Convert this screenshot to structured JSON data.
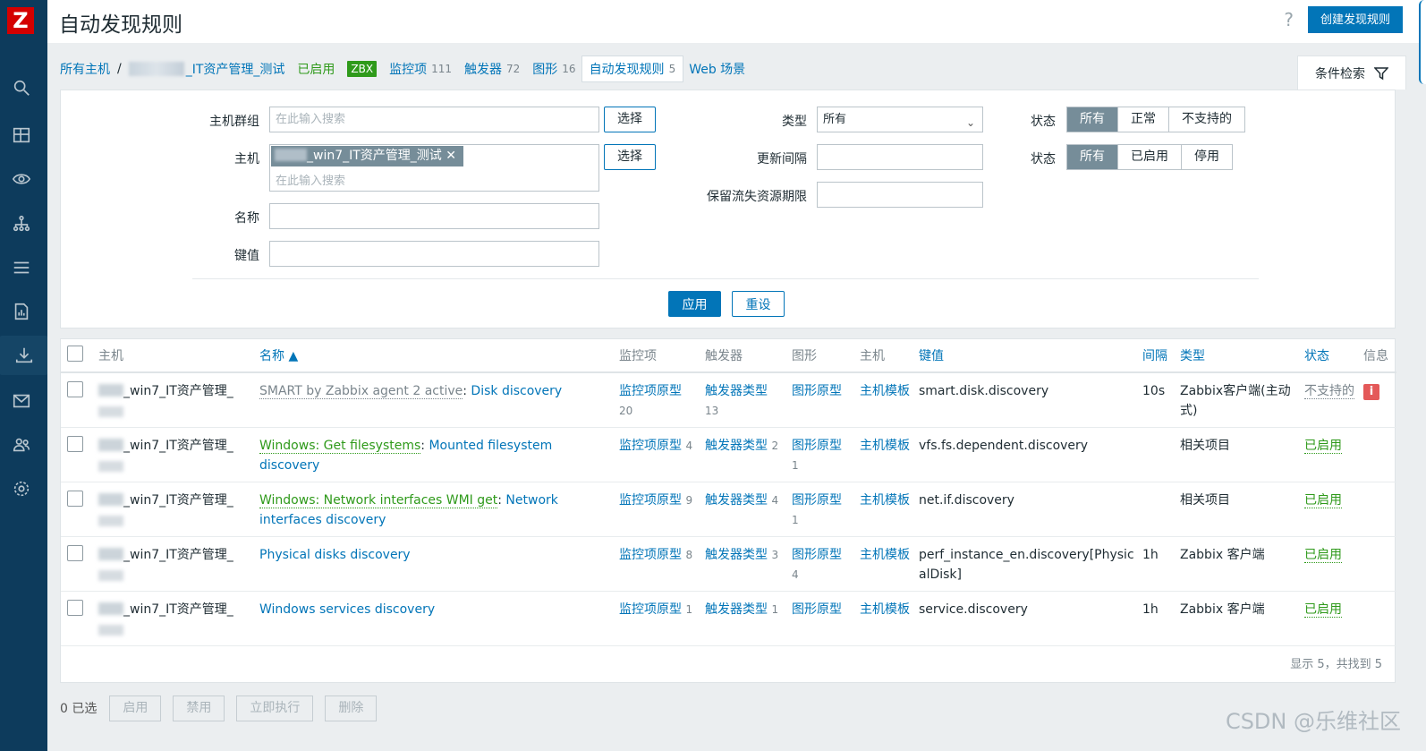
{
  "sidebar": {
    "logo": "Z",
    "icons": [
      "search-icon",
      "dashboard-icon",
      "monitoring-eye-icon",
      "network-icon",
      "list-icon",
      "reports-icon",
      "data-collection-icon",
      "mail-icon",
      "users-icon",
      "gear-icon"
    ]
  },
  "header": {
    "title": "自动发现规则",
    "help": "?",
    "create_button": "创建发现规则"
  },
  "nav": {
    "all_hosts": "所有主机",
    "separator": "/",
    "host_name": "_IT资产管理_测试",
    "enabled": "已启用",
    "zbx": "ZBX",
    "items_label": "监控项",
    "items_count": "111",
    "triggers_label": "触发器",
    "triggers_count": "72",
    "graphs_label": "图形",
    "graphs_count": "16",
    "discovery_label": "自动发现规则",
    "discovery_count": "5",
    "web_label": "Web 场景",
    "filter_tab": "条件检索"
  },
  "filter": {
    "host_group_label": "主机群组",
    "host_group_placeholder": "在此输入搜索",
    "select_button": "选择",
    "host_label": "主机",
    "host_tag": "_win7_IT资产管理_测试",
    "host_placeholder": "在此输入搜索",
    "name_label": "名称",
    "key_label": "键值",
    "type_label": "类型",
    "type_value": "所有",
    "interval_label": "更新间隔",
    "lost_label": "保留流失资源期限",
    "state_label": "状态",
    "state_options": [
      "所有",
      "正常",
      "不支持的"
    ],
    "status_label": "状态",
    "status_options": [
      "所有",
      "已启用",
      "停用"
    ],
    "apply": "应用",
    "reset": "重设"
  },
  "table": {
    "headers": {
      "host": "主机",
      "name": "名称 ▲",
      "items": "监控项",
      "triggers": "触发器",
      "graphs": "图形",
      "hosts": "主机",
      "key": "键值",
      "interval": "间隔",
      "type": "类型",
      "status": "状态",
      "info": "信息"
    },
    "rows": [
      {
        "host": "_win7_IT资产管理_",
        "template": "SMART by Zabbix agent 2 active",
        "template_style": "gray",
        "name": "Disk discovery",
        "items": "监控项原型",
        "items_count": "20",
        "triggers": "触发器类型",
        "triggers_count": "13",
        "graphs": "图形原型",
        "graphs_count": "",
        "hosts": "主机模板",
        "key": "smart.disk.discovery",
        "interval": "10s",
        "type": "Zabbix客户端(主动式)",
        "status": "不支持的",
        "status_style": "gray",
        "info": "i"
      },
      {
        "host": "_win7_IT资产管理_",
        "template": "Windows: Get filesystems",
        "template_style": "green",
        "name": "Mounted filesystem discovery",
        "items": "监控项原型",
        "items_count": "4",
        "triggers": "触发器类型",
        "triggers_count": "2",
        "graphs": "图形原型",
        "graphs_count": "1",
        "hosts": "主机模板",
        "key": "vfs.fs.dependent.discovery",
        "interval": "",
        "type": "相关项目",
        "status": "已启用",
        "status_style": "green",
        "info": ""
      },
      {
        "host": "_win7_IT资产管理_",
        "template": "Windows: Network interfaces WMI get",
        "template_style": "green",
        "name": "Network interfaces discovery",
        "items": "监控项原型",
        "items_count": "9",
        "triggers": "触发器类型",
        "triggers_count": "4",
        "graphs": "图形原型",
        "graphs_count": "1",
        "hosts": "主机模板",
        "key": "net.if.discovery",
        "interval": "",
        "type": "相关项目",
        "status": "已启用",
        "status_style": "green",
        "info": ""
      },
      {
        "host": "_win7_IT资产管理_",
        "template": "",
        "template_style": "",
        "name": "Physical disks discovery",
        "items": "监控项原型",
        "items_count": "8",
        "triggers": "触发器类型",
        "triggers_count": "3",
        "graphs": "图形原型",
        "graphs_count": "4",
        "hosts": "主机模板",
        "key": "perf_instance_en.discovery[PhysicalDisk]",
        "interval": "1h",
        "type": "Zabbix 客户端",
        "status": "已启用",
        "status_style": "green",
        "info": ""
      },
      {
        "host": "_win7_IT资产管理_",
        "template": "",
        "template_style": "",
        "name": "Windows services discovery",
        "items": "监控项原型",
        "items_count": "1",
        "triggers": "触发器类型",
        "triggers_count": "1",
        "graphs": "图形原型",
        "graphs_count": "",
        "hosts": "主机模板",
        "key": "service.discovery",
        "interval": "1h",
        "type": "Zabbix 客户端",
        "status": "已启用",
        "status_style": "green",
        "info": ""
      }
    ],
    "footer": "显示 5，共找到 5"
  },
  "actions": {
    "selected": "0 已选",
    "enable": "启用",
    "disable": "禁用",
    "execute": "立即执行",
    "delete": "删除"
  },
  "watermark": "CSDN @乐维社区"
}
